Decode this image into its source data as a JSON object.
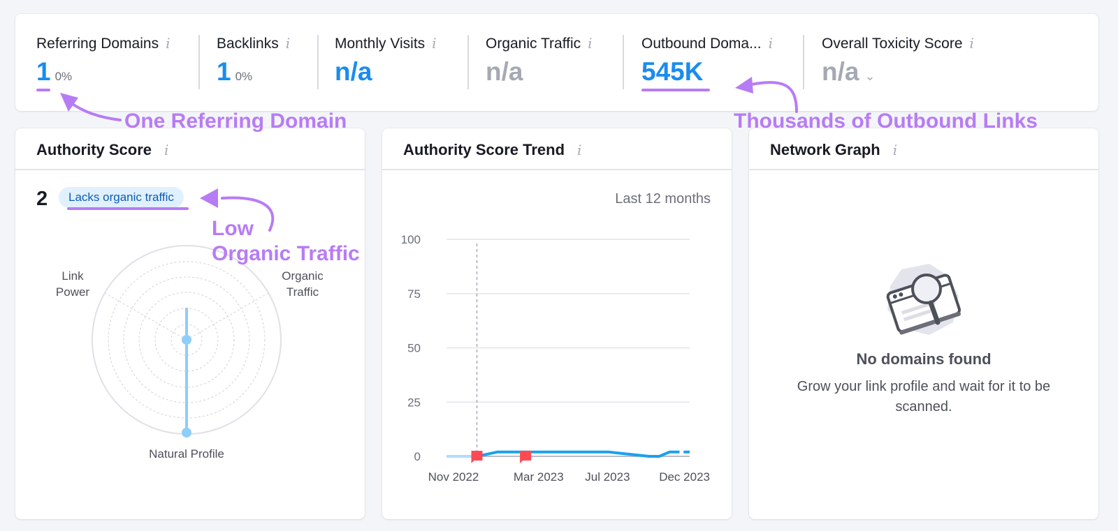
{
  "metrics": [
    {
      "label": "Referring Domains",
      "value": "1",
      "change": "0%",
      "tone": "blue"
    },
    {
      "label": "Backlinks",
      "value": "1",
      "change": "0%",
      "tone": "blue"
    },
    {
      "label": "Monthly Visits",
      "value": "n/a",
      "tone": "blue"
    },
    {
      "label": "Organic Traffic",
      "value": "n/a",
      "tone": "gray"
    },
    {
      "label": "Outbound Doma...",
      "value": "545K",
      "tone": "blue"
    },
    {
      "label": "Overall Toxicity Score",
      "value": "n/a",
      "tone": "gray",
      "dropdown": "chevron-down"
    }
  ],
  "info_glyph": "i",
  "annotations": {
    "referring": "One Referring Domain",
    "outbound": "Thousands of Outbound Links",
    "organic_line1": "Low",
    "organic_line2": "Organic Traffic",
    "color": "#b77cf5"
  },
  "authority_score": {
    "title": "Authority Score",
    "score": "2",
    "badge": "Lacks organic traffic",
    "radar": {
      "axes": [
        {
          "label_line1": "Link",
          "label_line2": "Power",
          "value": 0
        },
        {
          "label_line1": "Organic",
          "label_line2": "Traffic",
          "value": 0
        },
        {
          "label_line1": "Natural Profile",
          "label_line2": "",
          "value": 100
        }
      ]
    }
  },
  "trend": {
    "title": "Authority Score Trend",
    "period": "Last 12 months",
    "chart_data": {
      "type": "line",
      "title": "Authority Score Trend",
      "ylim": [
        0,
        100
      ],
      "yticks": [
        "100",
        "75",
        "50",
        "25",
        "0"
      ],
      "xticks": [
        "Nov 2022",
        "Mar 2023",
        "Jul 2023",
        "Dec 2023"
      ],
      "series": [
        {
          "name": "Authority Score",
          "x": [
            0,
            1.5,
            2,
            2.5,
            3,
            4,
            5,
            6,
            7,
            8,
            9,
            10,
            10.5,
            11,
            11.5,
            12
          ],
          "values": [
            0,
            0,
            1,
            2,
            2,
            2,
            2,
            2,
            2,
            2,
            1,
            0,
            0,
            2,
            2,
            2
          ]
        }
      ],
      "markers": [
        {
          "x": 1.5,
          "label": "flag"
        },
        {
          "x": 3.9,
          "label": "flag"
        }
      ],
      "grid": true
    }
  },
  "network": {
    "title": "Network Graph",
    "empty_title": "No domains found",
    "empty_desc": "Grow your link profile and wait for it to be scanned."
  }
}
